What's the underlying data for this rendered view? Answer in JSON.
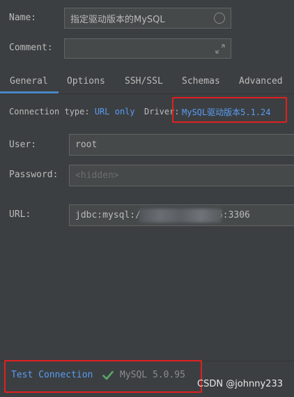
{
  "form": {
    "name_label": "Name:",
    "name_value": "指定驱动版本的MySQL",
    "comment_label": "Comment:",
    "comment_value": ""
  },
  "tabs": [
    {
      "label": "General",
      "active": true
    },
    {
      "label": "Options",
      "active": false
    },
    {
      "label": "SSH/SSL",
      "active": false
    },
    {
      "label": "Schemas",
      "active": false
    },
    {
      "label": "Advanced",
      "active": false
    }
  ],
  "connection": {
    "type_label": "Connection type:",
    "type_value": "URL only",
    "driver_label": "Driver:",
    "driver_value": "MySQL驱动版本5.1.24"
  },
  "fields": {
    "user_label": "User:",
    "user_value": "root",
    "password_label": "Password:",
    "password_placeholder": "<hidden>",
    "url_label": "URL:",
    "url_prefix": "jdbc:mysql:/",
    "url_suffix": "6:3306"
  },
  "footer": {
    "test_connection": "Test Connection",
    "status": "MySQL 5.0.95",
    "watermark": "CSDN @johnny233"
  },
  "colors": {
    "background": "#3c3f41",
    "link": "#589df6",
    "success": "#59a869",
    "highlight_box": "#e02020"
  }
}
